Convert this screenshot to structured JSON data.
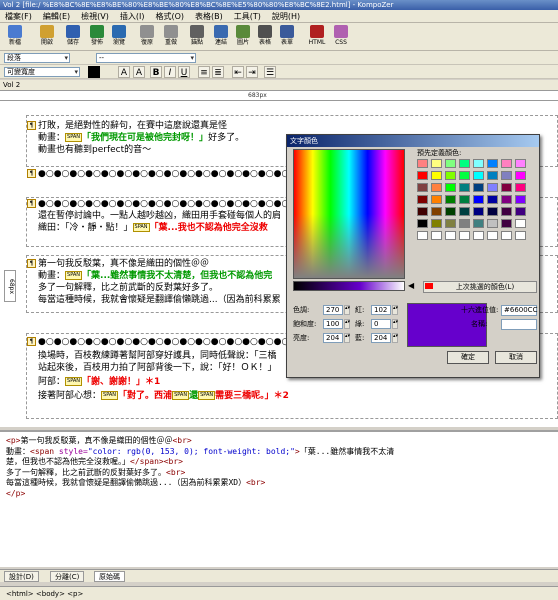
{
  "window": {
    "title": "Vol 2 [file:/ %E8%BC%8E%E8%BE%80%E8%BE%80%E8%BC%8E%E5%80%80%E8%BC%8E2.html] - KompoZer"
  },
  "menu": [
    "檔案(F)",
    "編輯(E)",
    "檢視(V)",
    "插入(I)",
    "格式(O)",
    "表格(B)",
    "工具(T)",
    "說明(H)"
  ],
  "toolbar": {
    "buttons": [
      {
        "label": "新檔",
        "icon": "new-icon",
        "color": "#4a7bd0"
      },
      {
        "label": "開啟",
        "icon": "open-icon",
        "color": "#d0a030"
      },
      {
        "label": "儲存",
        "icon": "save-icon",
        "color": "#3060b0"
      },
      {
        "label": "發佈",
        "icon": "publish-icon",
        "color": "#2a8a3a"
      },
      {
        "label": "瀏覽",
        "icon": "browse-icon",
        "color": "#2a6ab0"
      },
      {
        "label": "復原",
        "icon": "undo-icon",
        "color": "#909090"
      },
      {
        "label": "重做",
        "icon": "redo-icon",
        "color": "#909090"
      },
      {
        "label": "錨點",
        "icon": "anchor-icon",
        "color": "#606060"
      },
      {
        "label": "連結",
        "icon": "link-icon",
        "color": "#3a6ab0"
      },
      {
        "label": "圖片",
        "icon": "image-icon",
        "color": "#5a8a3a"
      },
      {
        "label": "表格",
        "icon": "table-icon",
        "color": "#505050"
      },
      {
        "label": "表單",
        "icon": "form-icon",
        "color": "#3a5a9a"
      },
      {
        "label": "HTML",
        "icon": "html-icon",
        "color": "#b02020"
      },
      {
        "label": "CSS",
        "icon": "css-icon",
        "color": "#b060b0"
      }
    ]
  },
  "format": {
    "paragraph_style": "段落",
    "font": "--",
    "width": "可變寬度",
    "bold": "B",
    "italic": "I",
    "underline": "U"
  },
  "tab": {
    "label": "Vol 2"
  },
  "ruler": {
    "label": "683px"
  },
  "sidebar_label": "68px",
  "editor": {
    "lines": {
      "l1": "打敗，是絕對性的辭句，在賽中這麼說還真是怪",
      "l2_a": "動畫：",
      "l2_b": "「我們現在可是被他完封呀！」",
      "l2_c": "好多了。",
      "l3": "動畫也有聽到perfect的音～",
      "l4": "●○●○●○●○●○●○●○●○●○●○●○●○●○●○●○●○●○●○●○●○",
      "l5": "●○●○●○●○●○●○●○●○●○●○●○●○●○●○●○●○●○●○",
      "l6": "還在暫停討論中。一點人越吵越凶，織田用手套碰每個人的肩",
      "l7_a": "織田：「冷・靜・點！」",
      "l7_b": "「葉...我也不認為他完全沒救",
      "l8": "第一句我反駁葉，真不像是織田的個性＠＠",
      "l9_a": "動畫：",
      "l9_b": "「葉...雖然事情我不太清楚，但我也不認為他完",
      "l10": "多了一句解釋，比之前武斷的反對葉好多了。",
      "l11": "每當這種時候，我就會懷疑是翻譯偷懶跳過...（因為前科累累",
      "l12": "●○●○●○●○●○●○●○●○●○●○●○●○●○●○●○●○●○●○",
      "l13": "換場時，百枝教練蹲著幫阿部穿好護具，同時低聲說：「三橋",
      "l14": "站起來後，百枝用力拍了阿部背後一下，說：「好！ＯＫ！」",
      "l15_a": "阿部：",
      "l15_b": "「謝、謝謝！」＊1",
      "l16_a": "接著阿部心想：",
      "l16_b": "「對了。西浦",
      "l16_c": "還",
      "l16_d": "需要三橋呢。」＊2",
      "span_tag": "SPAN"
    }
  },
  "code": {
    "p_open": "<p>",
    "line1_text": "第一句我反駁葉，真不像是織田的個性＠＠",
    "br": "<br>",
    "line2_prefix": "動畫：",
    "span_open": "<span ",
    "attr_name": "style=",
    "attr_val": "\"color: rgb(0, 153, 0); font-weight: bold;\"",
    "gt": ">",
    "line2_text": "「葉...雖然事情我不太清",
    "line3_text": "楚，但我也不認為他完全沒救喔。」",
    "span_close": "</span>",
    "line4_text": "多了一句解釋，比之前武斷的反對葉好多了。",
    "line5_text": "每當這種時候，我就會懷疑是翻譯偷懶跳過...（因為前科累累XD）",
    "p_close": "</p>"
  },
  "bottom_tabs": [
    "設計(D)",
    "分離(C)",
    "原始碼"
  ],
  "statusbar": "<html> <body> <p>",
  "dialog": {
    "title": "文字顏色",
    "predefined_label": "預先定義顏色:",
    "custom_button": "上次挑選的顏色(L)",
    "hue_label": "色調:",
    "hue": "270",
    "sat_label": "飽和度:",
    "sat": "100",
    "lum_label": "亮度:",
    "lum": "204",
    "red_label": "紅:",
    "red": "102",
    "green_label": "綠:",
    "green": "0",
    "blue_label": "藍:",
    "blue": "204",
    "hex_label": "十六進位值:",
    "hex": "#6600CC",
    "name_label": "名稱:",
    "name": "",
    "ok": "確定",
    "cancel": "取消",
    "selected_color": "#6600cc"
  }
}
